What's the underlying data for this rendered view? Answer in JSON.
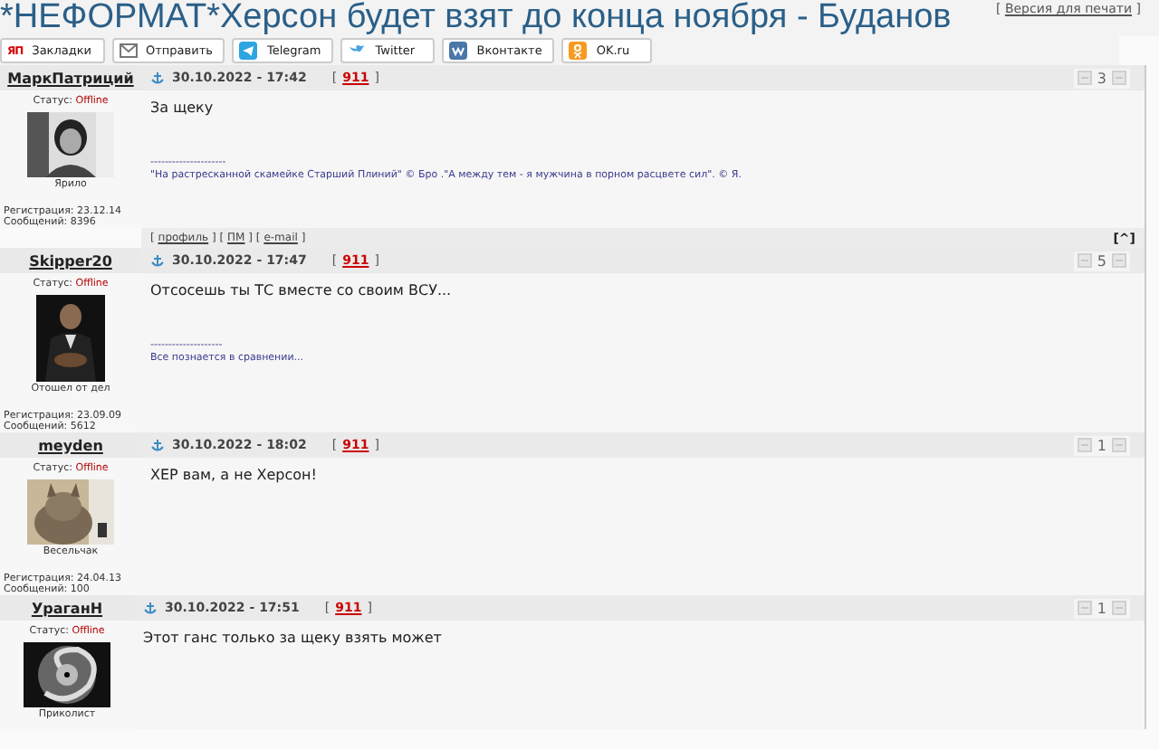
{
  "page": {
    "title": "*НЕФОРМАТ*Херсон будет взят до конца ноября - Буданов",
    "print_link": {
      "open": "[",
      "label": "Версия для печати",
      "close": "]"
    }
  },
  "share_buttons": [
    {
      "kind": "bookmarks",
      "icon_text": "ЯП",
      "label": "Закладки"
    },
    {
      "kind": "mail",
      "label": "Отправить"
    },
    {
      "kind": "telegram",
      "label": "Telegram"
    },
    {
      "kind": "twitter",
      "label": "Twitter"
    },
    {
      "kind": "vk",
      "label": "Вконтакте"
    },
    {
      "kind": "ok",
      "label": "OK.ru"
    }
  ],
  "posts": [
    {
      "author": "МаркПатриций",
      "status_label": "Статус:",
      "status": "Offline",
      "rank": "Ярило",
      "registered": "Регистрация: 23.12.14",
      "messages": "Сообщений: 8396",
      "date": "30.10.2022 - 17:42",
      "report": {
        "open": "[",
        "label": "911",
        "close": "]"
      },
      "rating": "3",
      "text": "За щеку",
      "signature": {
        "rule": "---------------------",
        "text": "\"На растресканной скамейке Старший Плиний\" © Бро .\"А между тем - я мужчина в порном расцвете сил\". © Я."
      },
      "footer": {
        "open": "[",
        "close": "]",
        "links": [
          "профиль",
          "ПМ",
          "e-mail"
        ],
        "top_link": "[^]"
      }
    },
    {
      "author": "Skipper20",
      "status_label": "Статус:",
      "status": "Offline",
      "rank": "Отошел от дел",
      "registered": "Регистрация: 23.09.09",
      "messages": "Сообщений: 5612",
      "date": "30.10.2022 - 17:47",
      "report": {
        "open": "[",
        "label": "911",
        "close": "]"
      },
      "rating": "5",
      "text": "Отсосешь ты ТС вместе со своим ВСУ...",
      "signature": {
        "rule": "--------------------",
        "text": "Все познается в сравнении..."
      }
    },
    {
      "author": "meyden",
      "status_label": "Статус:",
      "status": "Offline",
      "rank": "Весельчак",
      "registered": "Регистрация: 24.04.13",
      "messages": "Сообщений: 100",
      "date": "30.10.2022 - 18:02",
      "report": {
        "open": "[",
        "label": "911",
        "close": "]"
      },
      "rating": "1",
      "text": "ХЕР вам, а не Херсон!"
    },
    {
      "author": "УраганН",
      "status_label": "Статус:",
      "status": "Offline",
      "rank": "Приколист",
      "date": "30.10.2022 - 17:51",
      "report": {
        "open": "[",
        "label": "911",
        "close": "]"
      },
      "rating": "1",
      "text": "Этот ганс только за щеку взять может"
    }
  ]
}
